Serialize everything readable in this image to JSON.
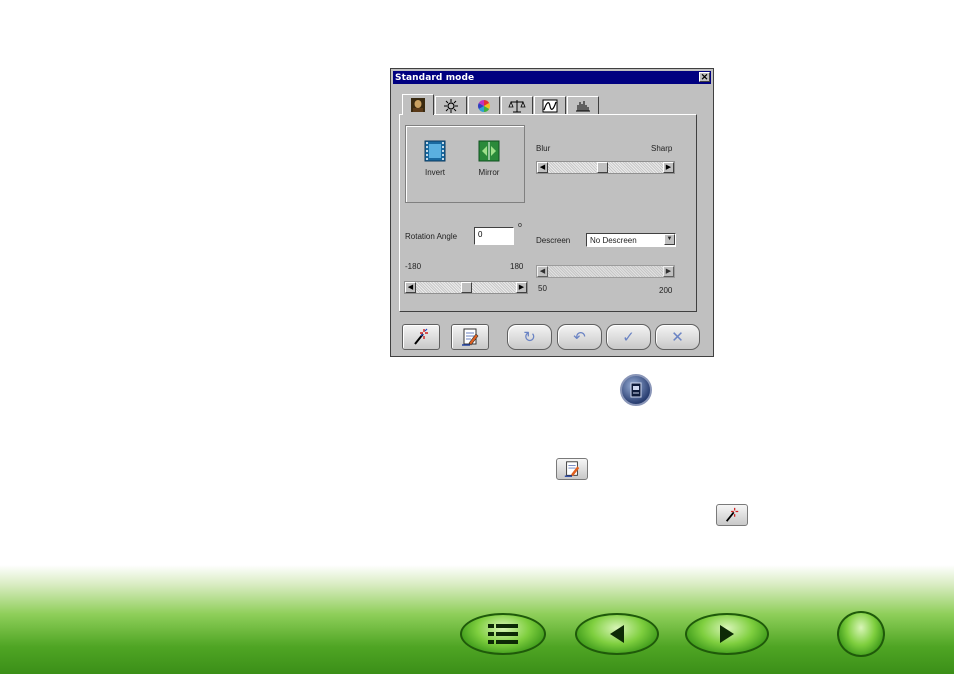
{
  "dialog": {
    "title": "Standard mode",
    "close_glyph": "✕",
    "tabs": [
      {
        "icon": "portrait-icon"
      },
      {
        "icon": "brightness-icon"
      },
      {
        "icon": "color-wheel-icon"
      },
      {
        "icon": "balance-icon"
      },
      {
        "icon": "curve-icon"
      },
      {
        "icon": "histogram-icon"
      }
    ],
    "tools": {
      "invert_label": "Invert",
      "mirror_label": "Mirror"
    },
    "blur_sharp": {
      "left_label": "Blur",
      "right_label": "Sharp",
      "level": 0.5
    },
    "rotation": {
      "label": "Rotation Angle",
      "value": "0",
      "degree_symbol": "o",
      "min_label": "-180",
      "max_label": "180",
      "level": 0.5
    },
    "descreen": {
      "label": "Descreen",
      "selected": "No Descreen",
      "min_label": "50",
      "max_label": "200"
    },
    "buttons": {
      "auto_icon": "magic-wand-icon",
      "apply_icon": "document-edit-icon",
      "reset_glyph": "↻",
      "undo_glyph": "↶",
      "ok_glyph": "✓",
      "cancel_glyph": "✕"
    }
  },
  "colors": {
    "titlebar": "#000080",
    "dialog_face": "#c0c0c0",
    "footer_green": "#4fa524",
    "accent_blue": "#6a83c4"
  },
  "footer_nav": {
    "contents_icon": "list-icon",
    "prev_icon": "triangle-left-icon",
    "next_icon": "triangle-right-icon",
    "home_icon": "circle-icon"
  }
}
